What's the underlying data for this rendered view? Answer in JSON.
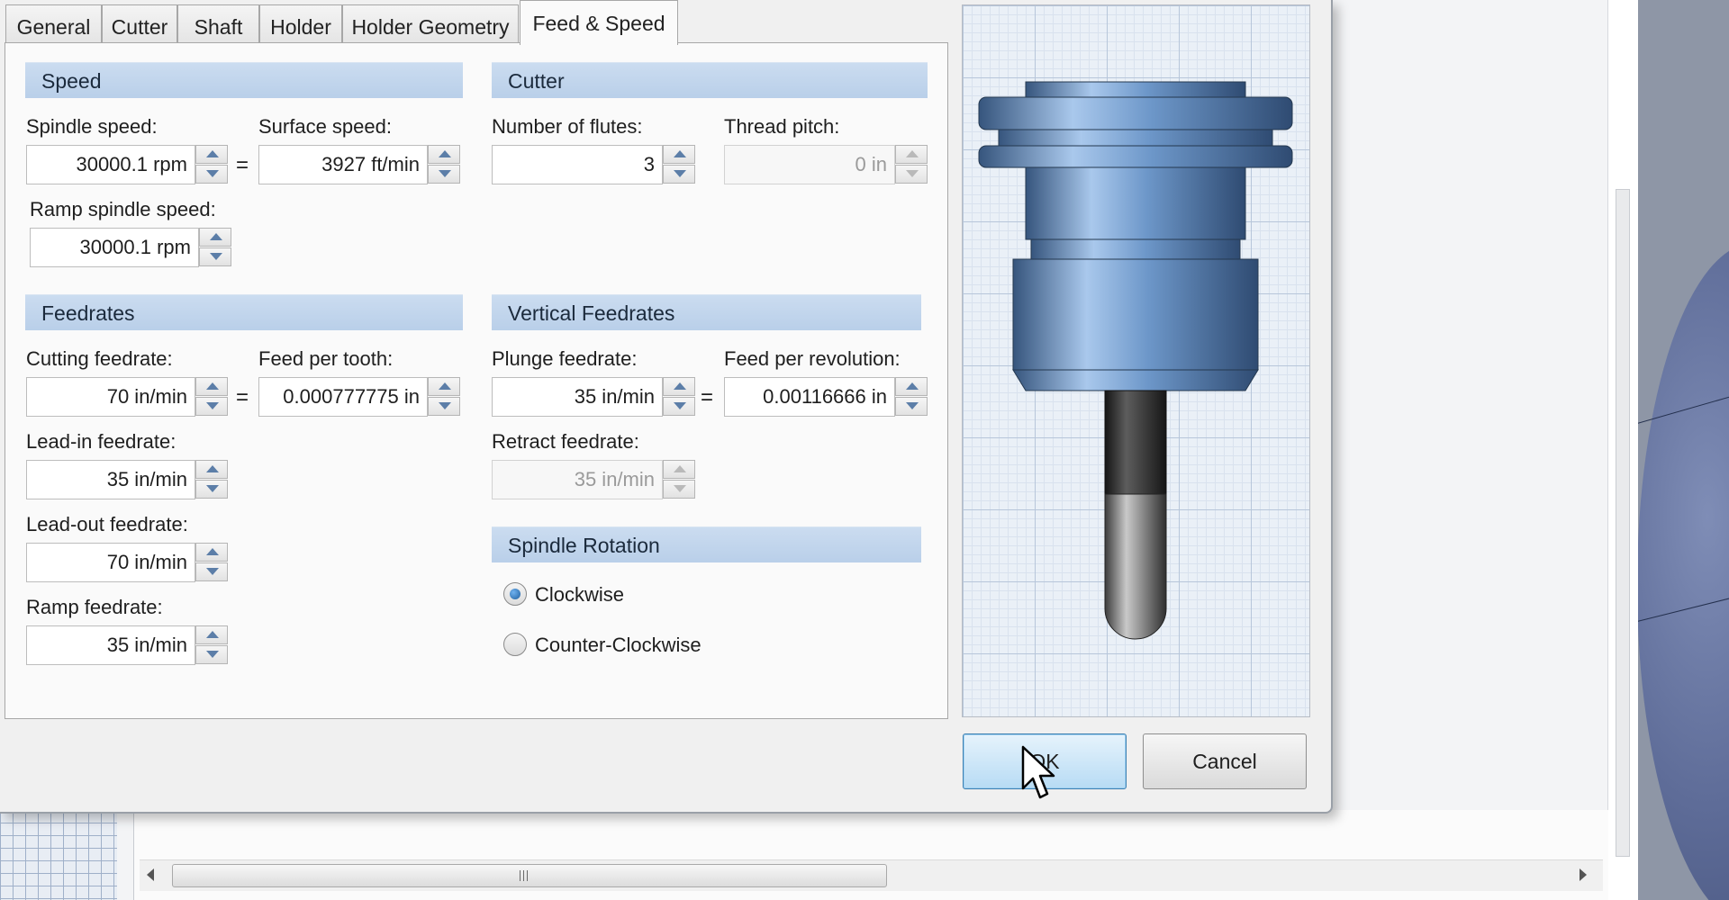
{
  "tabs": [
    "General",
    "Cutter",
    "Shaft",
    "Holder",
    "Holder Geometry",
    "Feed & Speed"
  ],
  "active_tab": "Feed & Speed",
  "speed": {
    "title": "Speed",
    "spindle_speed_label": "Spindle speed:",
    "spindle_speed_value": "30000.1 rpm",
    "surface_speed_label": "Surface speed:",
    "surface_speed_value": "3927 ft/min",
    "ramp_spindle_speed_label": "Ramp spindle speed:",
    "ramp_spindle_speed_value": "30000.1 rpm"
  },
  "cutter": {
    "title": "Cutter",
    "flutes_label": "Number of flutes:",
    "flutes_value": "3",
    "thread_pitch_label": "Thread pitch:",
    "thread_pitch_value": "0 in"
  },
  "feedrates": {
    "title": "Feedrates",
    "cutting_label": "Cutting feedrate:",
    "cutting_value": "70 in/min",
    "feed_per_tooth_label": "Feed per tooth:",
    "feed_per_tooth_value": "0.000777775 in",
    "lead_in_label": "Lead-in feedrate:",
    "lead_in_value": "35 in/min",
    "lead_out_label": "Lead-out feedrate:",
    "lead_out_value": "70 in/min",
    "ramp_label": "Ramp feedrate:",
    "ramp_value": "35 in/min"
  },
  "vertical_feedrates": {
    "title": "Vertical Feedrates",
    "plunge_label": "Plunge feedrate:",
    "plunge_value": "35 in/min",
    "feed_per_rev_label": "Feed per revolution:",
    "feed_per_rev_value": "0.00116666 in",
    "retract_label": "Retract feedrate:",
    "retract_value": "35 in/min"
  },
  "spindle_rotation": {
    "title": "Spindle Rotation",
    "options": [
      "Clockwise",
      "Counter-Clockwise"
    ],
    "selected": "Clockwise"
  },
  "equals_sign": "=",
  "buttons": {
    "ok": "OK",
    "cancel": "Cancel"
  },
  "icons": [
    "spin-up-icon",
    "spin-down-icon",
    "scroll-left-icon",
    "scroll-right-icon",
    "mouse-cursor-icon"
  ],
  "colors": {
    "section_header": "#c3d6ee",
    "default_button": "#b7dbf4",
    "tool_blue": "#5b89bf",
    "tool_shaft": "#3d3d3d"
  }
}
